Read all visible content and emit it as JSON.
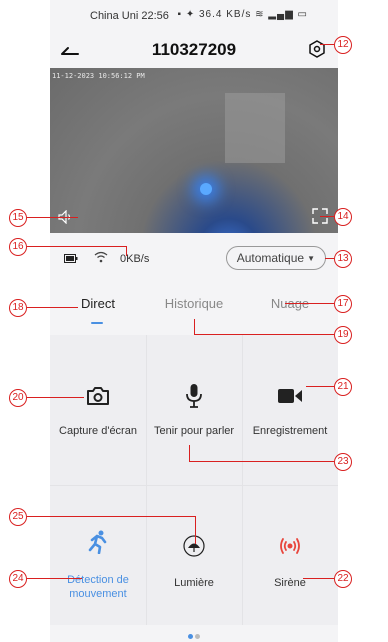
{
  "status_bar": {
    "carrier": "China Uni",
    "time": "22:56",
    "right_indicators": "36.4 KB/s"
  },
  "header": {
    "title": "110327209"
  },
  "video": {
    "timestamp": "11-12-2023 10:56:12 PM"
  },
  "info": {
    "speed": "0KB/s",
    "mode": "Automatique"
  },
  "tabs": [
    {
      "label": "Direct"
    },
    {
      "label": "Historique"
    },
    {
      "label": "Nuage"
    }
  ],
  "actions": {
    "screenshot": "Capture d'écran",
    "talk": "Tenir pour parler",
    "record": "Enregistrement",
    "motion_line1": "Détection de",
    "motion_line2": "mouvement",
    "light": "Lumière",
    "siren": "Sirène"
  },
  "callouts": [
    "12",
    "13",
    "14",
    "15",
    "16",
    "17",
    "18",
    "19",
    "20",
    "21",
    "22",
    "23",
    "24",
    "25"
  ],
  "colors": {
    "accent": "#4a90e2",
    "annotation": "#d92020",
    "siren": "#e8453c"
  }
}
